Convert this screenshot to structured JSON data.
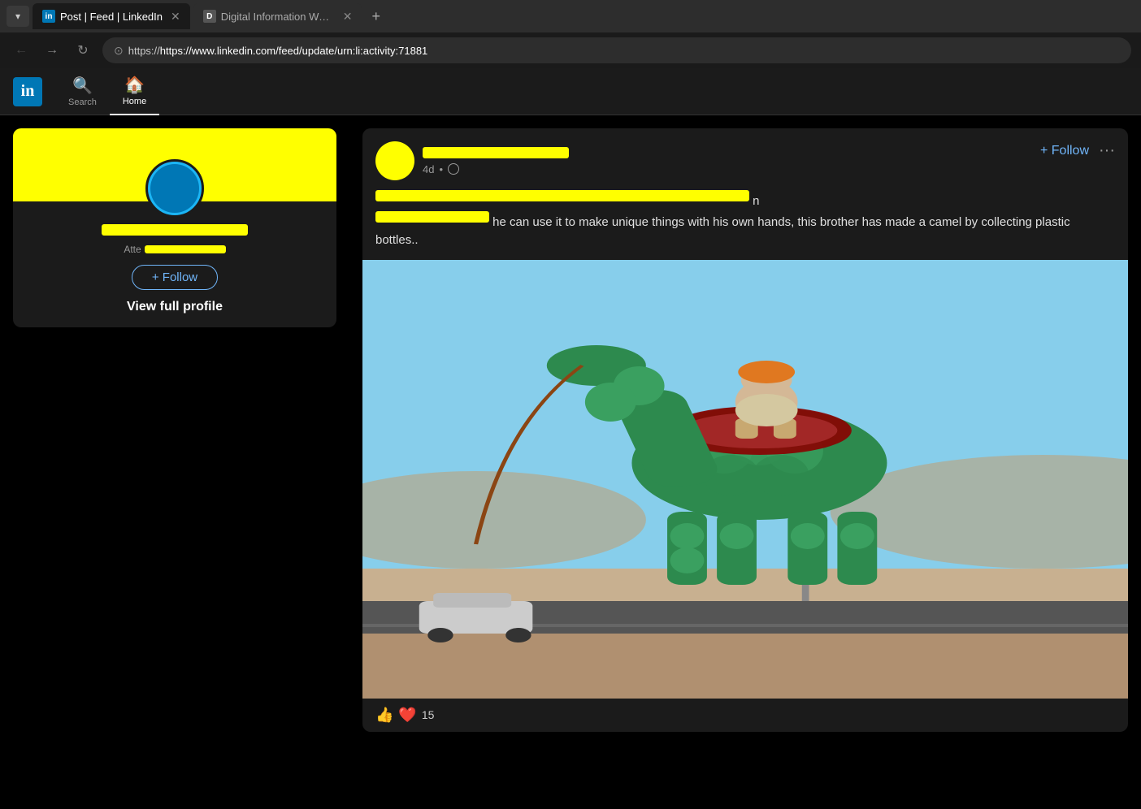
{
  "browser": {
    "tabs": [
      {
        "id": "tab1",
        "favicon": "in",
        "label": "Post | Feed | LinkedIn",
        "active": true,
        "favicon_type": "linkedin"
      },
      {
        "id": "tab2",
        "favicon": "D",
        "label": "Digital Information World",
        "active": false,
        "favicon_type": "d-favicon"
      }
    ],
    "url": "https://www.linkedin.com/feed/update/urn:li:activity:71881"
  },
  "linkedin_nav": {
    "search_label": "Search",
    "home_label": "Home"
  },
  "profile_card": {
    "att_label": "Atte",
    "follow_btn": "+ Follow",
    "view_profile": "View full profile"
  },
  "post": {
    "time": "4d",
    "follow_label": "+ Follow",
    "more_label": "···",
    "text_part1": "he can use it to make unique things with his own hands, this brother has made a camel by collecting plastic bottles..",
    "reaction_count": "15"
  }
}
